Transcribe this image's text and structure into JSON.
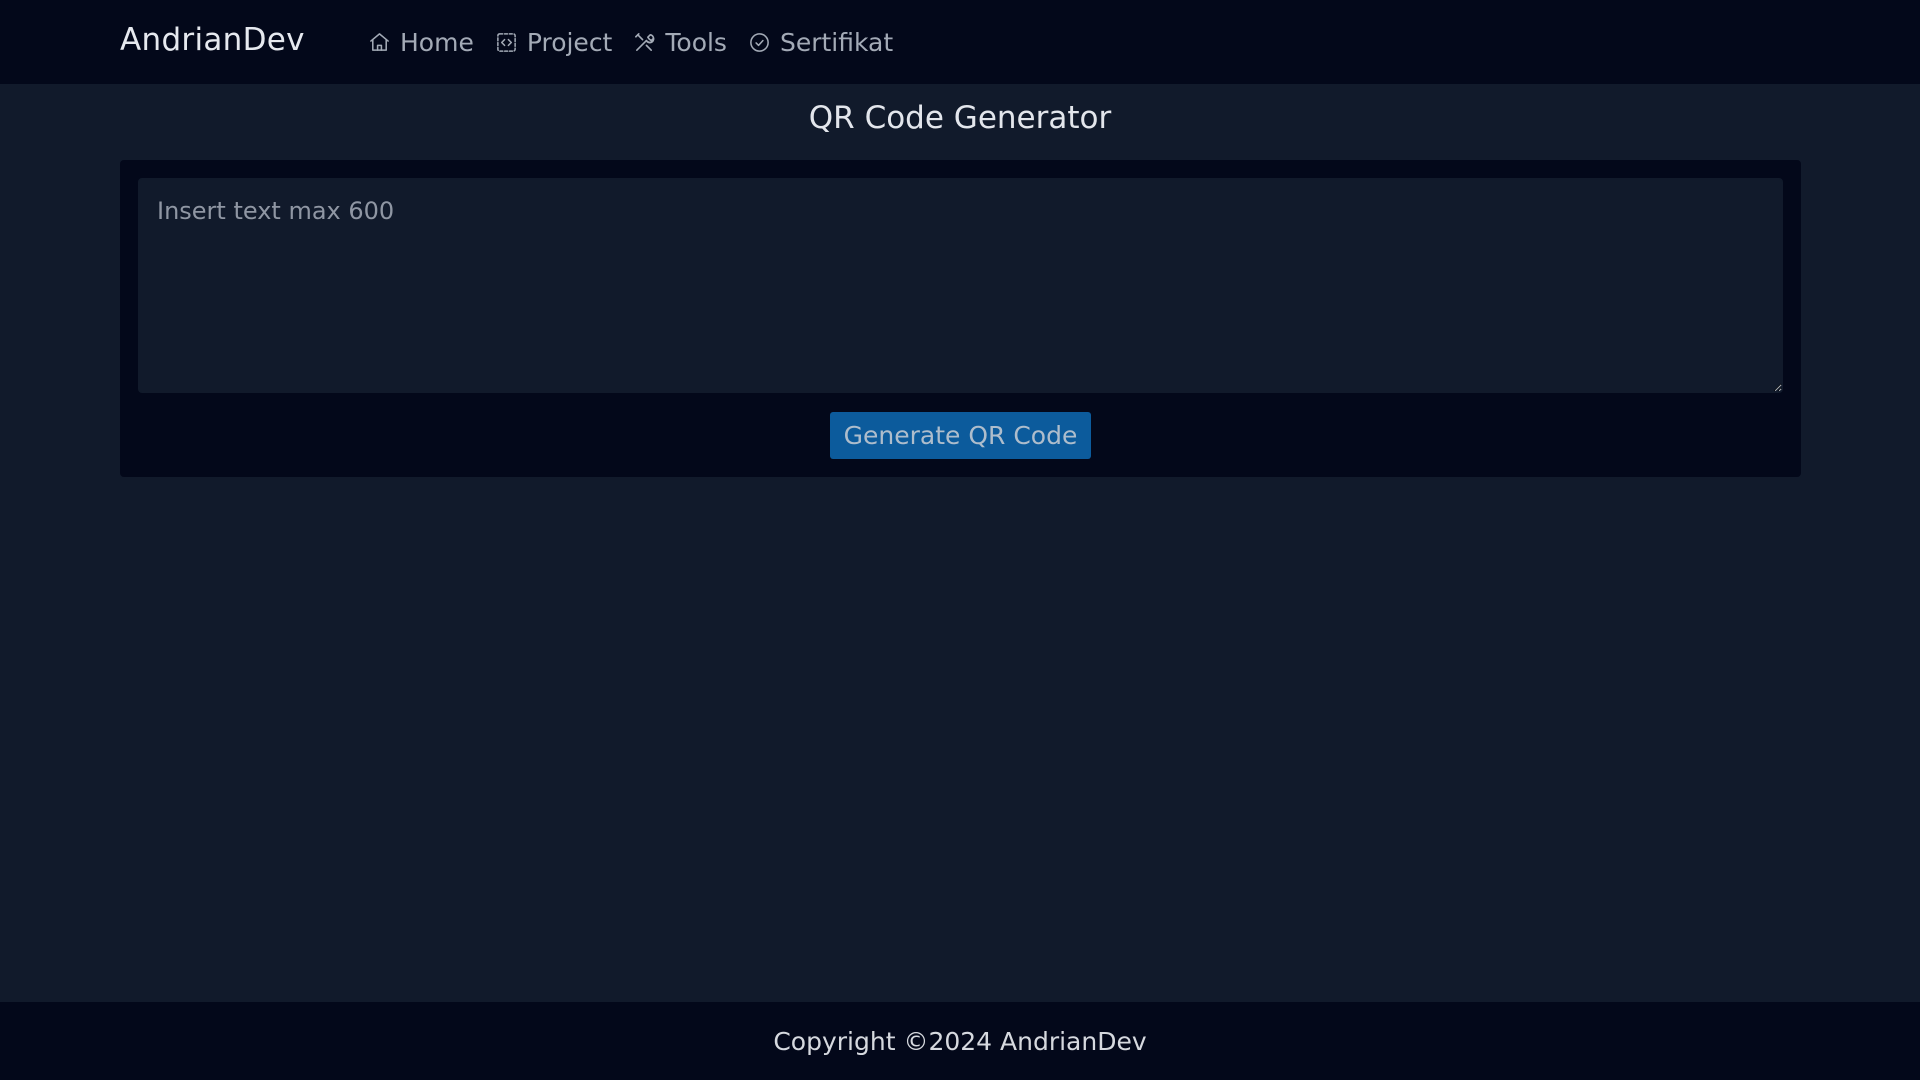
{
  "header": {
    "brand": "AndrianDev",
    "nav": [
      {
        "label": "Home",
        "icon": "home-icon"
      },
      {
        "label": "Project",
        "icon": "code-square-icon"
      },
      {
        "label": "Tools",
        "icon": "tools-icon"
      },
      {
        "label": "Sertifikat",
        "icon": "check-circle-icon"
      }
    ]
  },
  "main": {
    "title": "QR Code Generator",
    "input_placeholder": "Insert text max 600",
    "input_value": "",
    "generate_label": "Generate QR Code"
  },
  "footer": {
    "copyright": "Copyright ©2024 AndrianDev"
  },
  "colors": {
    "background": "#111a2b",
    "bar": "#03081a",
    "button": "#0c5b9c"
  }
}
